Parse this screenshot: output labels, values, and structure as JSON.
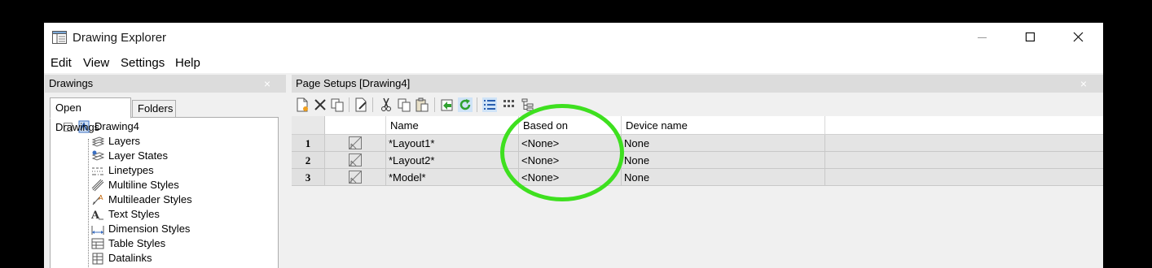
{
  "window": {
    "title": "Drawing Explorer",
    "icon": "drawing-explorer-icon",
    "controls": [
      "minimize-icon",
      "maximize-icon",
      "close-icon"
    ]
  },
  "menu": [
    "Edit",
    "View",
    "Settings",
    "Help"
  ],
  "left_panel": {
    "title": "Drawings",
    "close_symbol": "×",
    "tabs": [
      "Open Drawings",
      "Folders"
    ],
    "active_tab": "Open Drawings",
    "tree": {
      "expander": "−",
      "root": "Drawing4",
      "items": [
        "Layers",
        "Layer States",
        "Linetypes",
        "Multiline Styles",
        "Multileader Styles",
        "Text Styles",
        "Dimension Styles",
        "Table Styles",
        "Datalinks"
      ]
    }
  },
  "right_panel": {
    "title": "Page Setups [Drawing4]",
    "close_symbol": "×",
    "toolbar": [
      "new-icon",
      "delete-icon",
      "copy-to-icon",
      "edit-icon",
      "cut-icon",
      "copy-icon",
      "paste-icon",
      "import-icon",
      "refresh-icon",
      "details-view-icon",
      "tiles-view-icon",
      "tree-view-icon"
    ],
    "columns": [
      "Name",
      "Based on",
      "Device name"
    ],
    "rows": [
      {
        "num": "1",
        "name": "*Layout1*",
        "based_on": "<None>",
        "device": "None"
      },
      {
        "num": "2",
        "name": "*Layout2*",
        "based_on": "<None>",
        "device": "None"
      },
      {
        "num": "3",
        "name": "*Model*",
        "based_on": "<None>",
        "device": "None"
      }
    ]
  },
  "annotation": {
    "shape": "ellipse",
    "color": "#3ee01f"
  }
}
